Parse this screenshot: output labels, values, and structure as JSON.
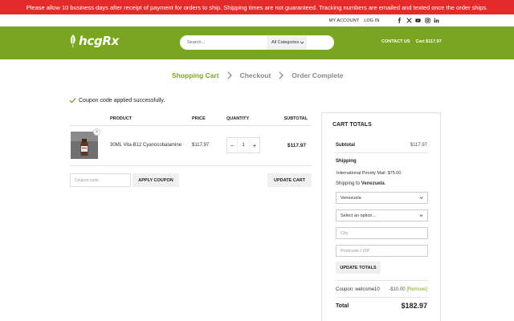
{
  "notice": {
    "text": "Please allow 10 business days after receipt of payment for orders to ship. Shipping times are not guaranteed. Tracking numbers are emailed and texted once the order ships.",
    "bg_color": "#e32b2b"
  },
  "topbar": {
    "my_account": "MY ACCOUNT",
    "log_in": "LOG IN",
    "socials": [
      "facebook-icon",
      "x-icon",
      "youtube-icon",
      "instagram-icon",
      "linkedin-icon"
    ]
  },
  "header": {
    "brand": "hcgRx",
    "bg_color": "#79a620",
    "search_placeholder": "Search...",
    "category_label": "All Categories",
    "contact_label": "CONTACT US",
    "cart_label": "Cart $117.97"
  },
  "steps": {
    "items": [
      "Shopping Cart",
      "Checkout",
      "Order Complete"
    ],
    "active": "Shopping Cart"
  },
  "coupon_message": "Coupon code applied successfully.",
  "cart": {
    "headers": {
      "product": "PRODUCT",
      "price": "PRICE",
      "quantity": "QUANTITY",
      "subtotal": "SUBTOTAL"
    },
    "items": [
      {
        "name": "30ML Vita-B12 Cyanocobalamine",
        "price": "$117.97",
        "quantity": "1",
        "subtotal": "$117.97"
      }
    ],
    "remove_glyph": "×",
    "qty_minus": "−",
    "qty_plus": "+",
    "coupon_placeholder": "Coupon code",
    "apply_coupon": "APPLY COUPON",
    "update_cart": "UPDATE CART"
  },
  "totals": {
    "title": "CART TOTALS",
    "subtotal_label": "Subtotal",
    "subtotal_value": "$117.97",
    "shipping_label": "Shipping",
    "shipping_method": "International Priority Mail: $75.00",
    "shipping_to_prefix": "Shipping to ",
    "shipping_country": "Venezuela",
    "shipping_to_suffix": ".",
    "country_select": "Venezuela",
    "state_select": "Select an option...",
    "city_placeholder": "City",
    "postcode_placeholder": "Postcode / ZIP",
    "update_totals": "UPDATE TOTALS",
    "coupon_label": "Coupon: welcome10",
    "coupon_value": "-$10.00",
    "coupon_remove": "[Remove]",
    "total_label": "Total",
    "total_value": "$182.97",
    "accent_color": "#79a620"
  }
}
